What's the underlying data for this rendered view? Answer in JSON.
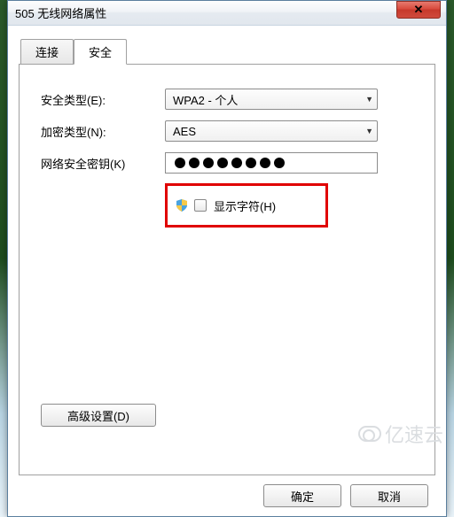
{
  "window": {
    "title": "505 无线网络属性",
    "close_symbol": "✕"
  },
  "tabs": {
    "connection": "连接",
    "security": "安全"
  },
  "form": {
    "security_type_label": "安全类型(E):",
    "security_type_value": "WPA2 - 个人",
    "encryption_type_label": "加密类型(N):",
    "encryption_type_value": "AES",
    "network_key_label": "网络安全密钥(K)",
    "network_key_dot_count": 8,
    "show_chars_label": "显示字符(H)",
    "show_chars_checked": false,
    "advanced_button": "高级设置(D)"
  },
  "buttons": {
    "ok": "确定",
    "cancel": "取消"
  },
  "watermark": "亿速云"
}
